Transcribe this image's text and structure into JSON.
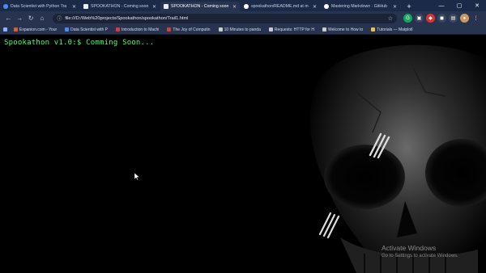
{
  "tabs": [
    {
      "title": "Data Scientist with Python Tra",
      "favicon_color": "#4c8bf5",
      "active": false
    },
    {
      "title": "SPOOKATHON - Coming soon",
      "favicon_color": "#e8ecf4",
      "active": false
    },
    {
      "title": "SPOOKATHON - Coming soon",
      "favicon_color": "#e8ecf4",
      "active": true
    },
    {
      "title": "spookathon/README.md at m",
      "favicon_color": "#ffffff",
      "active": false
    },
    {
      "title": "Mastering Markdown · GitHub",
      "favicon_color": "#ffffff",
      "active": false
    }
  ],
  "toolbar": {
    "url": "file:///D:/Web%20projects/Spookathon/spookathon/Trail1.html"
  },
  "bookmarks": [
    {
      "label": "Expanion.com - Your",
      "color": "#e05a2b"
    },
    {
      "label": "Data Scientist with P",
      "color": "#4c8bf5"
    },
    {
      "label": "Introduction to Machi",
      "color": "#d83b3b"
    },
    {
      "label": "The Joy of Computin",
      "color": "#d83b3b"
    },
    {
      "label": "10 Minutes to panda",
      "color": "#cccccc"
    },
    {
      "label": "Requests: HTTP for H",
      "color": "#cccccc"
    },
    {
      "label": "Welcome to How to",
      "color": "#cccccc"
    },
    {
      "label": "Tutorials — Matplotl",
      "color": "#f0c040"
    }
  ],
  "terminal": {
    "prompt": "Spookathon v1.0:$ Comming Soon..."
  },
  "watermark": {
    "title": "Activate Windows",
    "subtitle": "Go to Settings to activate Windows."
  },
  "colors": {
    "terminal_text": "#4cff6a",
    "tab_strip": "#1c2a4a",
    "toolbar": "#27334f"
  }
}
